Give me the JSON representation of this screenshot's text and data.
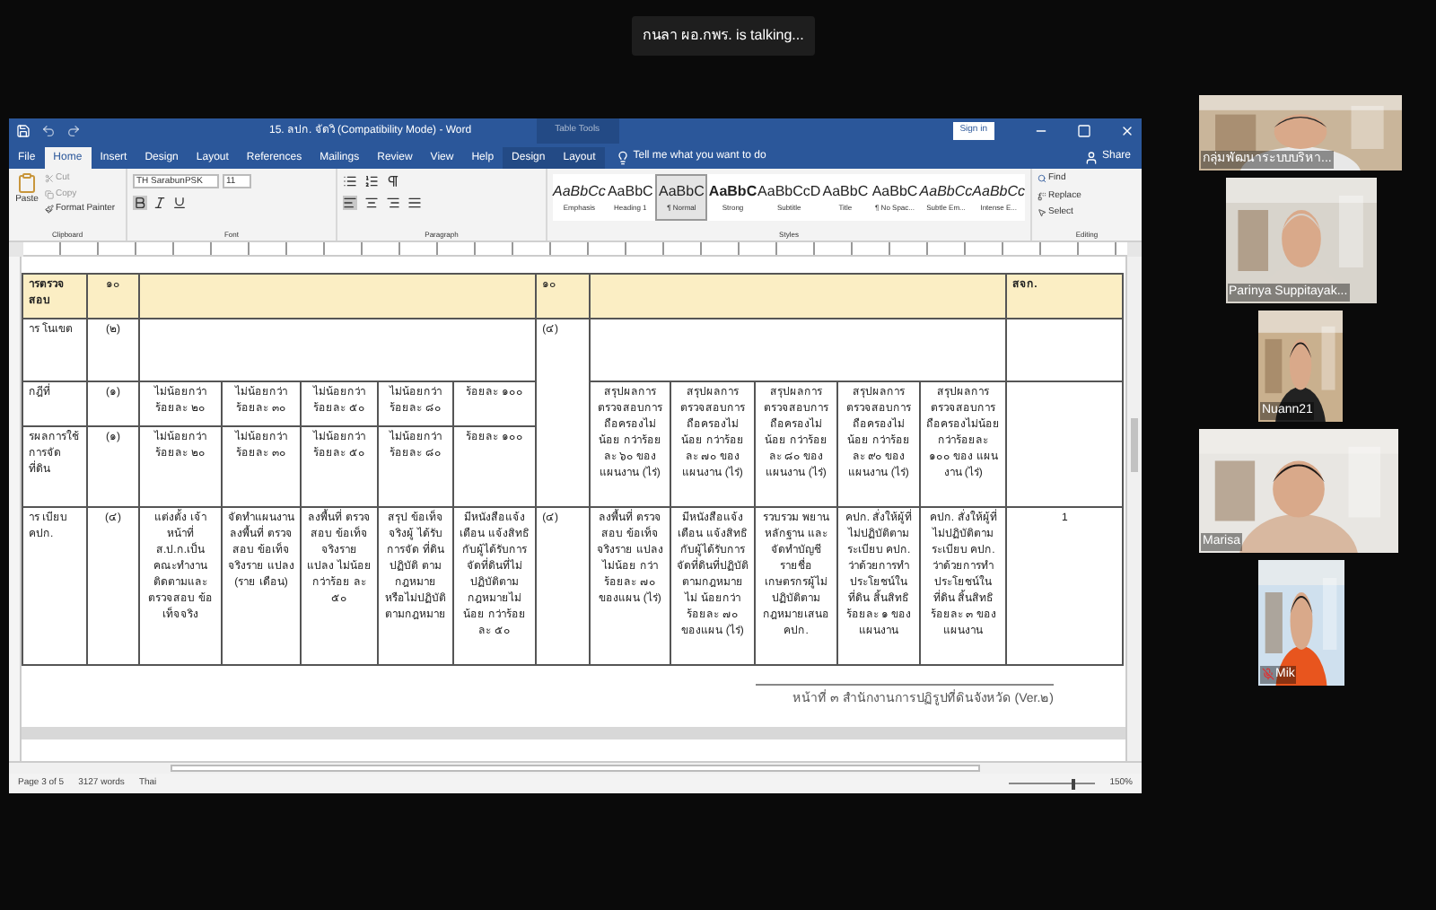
{
  "talking_banner": "กนลา ผอ.กพร. is talking...",
  "window": {
    "title": "15. ลปก. จัดวิ (Compatibility Mode) - Word",
    "context_tab": "Table Tools",
    "sign_in": "Sign in"
  },
  "tabs": [
    {
      "label": "File",
      "selected": false
    },
    {
      "label": "Home",
      "selected": true
    },
    {
      "label": "Insert",
      "selected": false
    },
    {
      "label": "Design",
      "selected": false
    },
    {
      "label": "Layout",
      "selected": false
    },
    {
      "label": "References",
      "selected": false
    },
    {
      "label": "Mailings",
      "selected": false
    },
    {
      "label": "Review",
      "selected": false
    },
    {
      "label": "View",
      "selected": false
    },
    {
      "label": "Help",
      "selected": false
    },
    {
      "label": "Design",
      "selected": false
    },
    {
      "label": "Layout",
      "selected": false
    }
  ],
  "tell_me": "Tell me what you want to do",
  "share": "Share",
  "ribbon": {
    "clipboard": {
      "paste": "Paste",
      "cut": "Cut",
      "copy": "Copy",
      "format_painter": "Format Painter",
      "label": "Clipboard"
    },
    "font": {
      "name": "TH SarabunPSK",
      "size": "11",
      "label": "Font"
    },
    "paragraph": {
      "label": "Paragraph"
    },
    "styles": {
      "items": [
        {
          "sample": "AaBbCc",
          "name": "Emphasis",
          "selected": false
        },
        {
          "sample": "AaBbC",
          "name": "Heading 1",
          "selected": false
        },
        {
          "sample": "AaBbC",
          "name": "¶ Normal",
          "selected": true
        },
        {
          "sample": "AaBbC",
          "name": "Strong",
          "selected": false
        },
        {
          "sample": "AaBbCcD",
          "name": "Subtitle",
          "selected": false
        },
        {
          "sample": "AaBbC",
          "name": "Title",
          "selected": false
        },
        {
          "sample": "AaBbC",
          "name": "¶ No Spac...",
          "selected": false
        },
        {
          "sample": "AaBbCc",
          "name": "Subtle Em...",
          "selected": false
        },
        {
          "sample": "AaBbCc",
          "name": "Intense E...",
          "selected": false
        }
      ],
      "label": "Styles"
    },
    "editing": {
      "find": "Find",
      "replace": "Replace",
      "select": "Select",
      "label": "Editing"
    }
  },
  "table": {
    "rows": [
      {
        "kind": "header",
        "label": "ารตรวจสอบ",
        "number": "๑๐",
        "right_number": "๑๐",
        "last": "สจก."
      },
      {
        "kind": "body",
        "label": "าร โนเขต",
        "number": "(๒)",
        "right_number": "(๔)"
      },
      {
        "kind": "body",
        "label": "กฎีที่",
        "number": "(๑)",
        "cells": [
          "ไม่น้อยกว่า ร้อยละ ๒๐",
          "ไม่น้อยกว่า ร้อยละ ๓๐",
          "ไม่น้อยกว่า ร้อยละ ๕๐",
          "ไม่น้อยกว่า ร้อยละ ๘๐",
          "ร้อยละ ๑๐๐"
        ],
        "right_cells": [
          "สรุปผลการ ตรวจสอบการ ถือครองไม่น้อย กว่าร้อยละ ๖๐ ของแผนงาน (ไร่)",
          "สรุปผลการ ตรวจสอบการ ถือครองไม่น้อย กว่าร้อยละ ๗๐ ของแผนงาน (ไร่)",
          "สรุปผลการ ตรวจสอบการ ถือครองไม่น้อย กว่าร้อยละ ๘๐ ของแผนงาน (ไร่)",
          "สรุปผลการ ตรวจสอบการ ถือครองไม่น้อย กว่าร้อยละ ๙๐ ของแผนงาน (ไร่)",
          "สรุปผลการ ตรวจสอบการ ถือครองไม่น้อย กว่าร้อยละ ๑๐๐ ของ แผนงาน (ไร่)"
        ]
      },
      {
        "kind": "body",
        "label": "รผลการใช้ การจัดที่ดิน",
        "number": "(๑)",
        "cells": [
          "ไม่น้อยกว่า ร้อยละ ๒๐",
          "ไม่น้อยกว่า ร้อยละ ๓๐",
          "ไม่น้อยกว่า ร้อยละ ๕๐",
          "ไม่น้อยกว่า ร้อยละ ๘๐",
          "ร้อยละ ๑๐๐"
        ]
      },
      {
        "kind": "body",
        "label": "าร เบียบ คปก.",
        "number": "(๔)",
        "cells": [
          "แต่งตั้ง เจ้าหน้าที่ ส.ป.ก.เป็น คณะทำงาน ติดตามและ ตรวจสอบ ข้อเท็จจริง",
          "จัดทำแผนงาน ลงพื้นที่ ตรวจสอบ ข้อเท็จจริงราย แปลง (ราย เดือน)",
          "ลงพื้นที่ ตรวจสอบ ข้อเท็จจริงราย แปลง ไม่น้อยกว่าร้อย ละ ๕๐",
          "สรุป ข้อเท็จจริงผู้ ได้รับการจัด ที่ดินปฏิบัติ ตามกฎหมาย หรือไม่ปฏิบัติ ตามกฎหมาย",
          "มีหนังสือแจ้ง เตือน แจ้งสิทธิ กับผู้ได้รับการ จัดที่ดินที่ไม่ ปฏิบัติตาม กฎหมายไม่น้อย กว่าร้อยละ ๕๐"
        ],
        "right_number": "(๔)",
        "right_cells": [
          "ลงพื้นที่ ตรวจสอบ ข้อเท็จจริงราย แปลง ไม่น้อย กว่าร้อยละ ๗๐ ของแผน (ไร่)",
          "มีหนังสือแจ้ง เตือน แจ้งสิทธิ กับผู้ได้รับการ จัดที่ดินที่ปฏิบัติ ตามกฎหมายไม่ น้อยกว่าร้อยละ ๗๐ ของแผน (ไร่)",
          "รวบรวม พยานหลักฐาน และจัดทำบัญชี รายชื่อ เกษตรกรผู้ไม่ ปฏิบัติตาม กฎหมายเสนอ คปก.",
          "คปก. สั่งให้ผู้ที่ ไม่ปฏิบัติตาม ระเบียบ คปก. ว่าด้วยการทำ ประโยชน์ใน ที่ดิน สิ้นสิทธิ ร้อยละ ๑ ของ แผนงาน",
          "คปก. สั่งให้ผู้ที่ ไม่ปฏิบัติตาม ระเบียบ คปก. ว่าด้วยการทำ ประโยชน์ใน ที่ดิน สิ้นสิทธิ ร้อยละ ๓ ของ แผนงาน"
        ],
        "last": "1"
      }
    ]
  },
  "page_footer": "หน้าที่ ๓ สำนักงานการปฏิรูปที่ดินจังหวัด (Ver.๒)",
  "status_bar": {
    "page": "Page 3 of 5",
    "words": "3127 words",
    "language": "Thai",
    "zoom": "150%",
    "level": 0.75
  },
  "participants": [
    {
      "name": "กลุ่มพัฒนาระบบบริหา...",
      "muted": false
    },
    {
      "name": "Parinya Suppitayak...",
      "muted": false
    },
    {
      "name": "Nuann21",
      "muted": false
    },
    {
      "name": "Marisa",
      "muted": false
    },
    {
      "name": "Mik",
      "muted": true
    }
  ]
}
